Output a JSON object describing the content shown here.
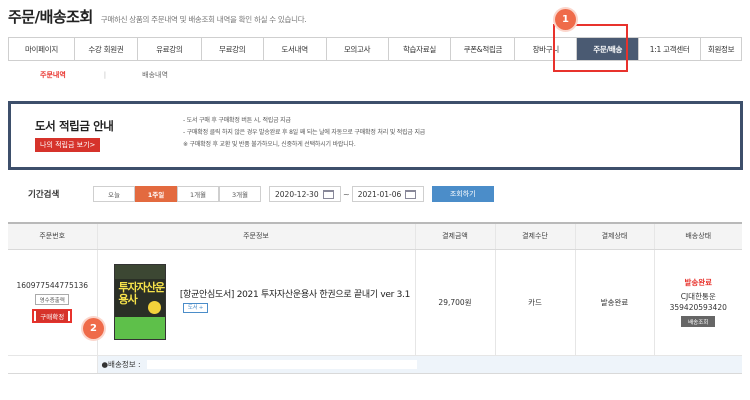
{
  "header": {
    "title": "주문/배송조회",
    "subtitle": "구매하신 상품의 주문내역 및 배송조회 내역을 확인 하실 수 있습니다."
  },
  "nav": {
    "items": [
      {
        "label": "마이페이지"
      },
      {
        "label": "수강 회원권"
      },
      {
        "label": "유료강의"
      },
      {
        "label": "무료강의"
      },
      {
        "label": "도서내역"
      },
      {
        "label": "모의고사"
      },
      {
        "label": "학습자료실"
      },
      {
        "label": "쿠폰&적립금"
      },
      {
        "label": "장바구니"
      },
      {
        "label": "주문/배송",
        "active": true
      },
      {
        "label": "1:1 고객센터"
      },
      {
        "label": "회원정보"
      }
    ]
  },
  "subtabs": {
    "order_history": "주문내역",
    "separator": "|",
    "delivery_history": "배송내역"
  },
  "info_panel": {
    "title": "도서 적립금 안내",
    "button_label": "나의 적립금 보기>",
    "lines": [
      "- 도서 구매 후 구매확정 버튼 시, 적립금 지급",
      "- 구매확정 클릭 하지 않은 경우 발송완료 후 8일 째 되는 날에 자동으로 구매확정 처리 및 적립금 지급",
      "※ 구매확정 후 교환 및 반품 불가하오니, 신중하게 선택하시기 바랍니다."
    ]
  },
  "period": {
    "label": "기간검색",
    "buttons": [
      "오늘",
      "1주일",
      "1개월",
      "3개월"
    ],
    "active_index": 1,
    "start_date": "2020-12-30",
    "tilde": "~",
    "end_date": "2021-01-06",
    "search_label": "조회하기"
  },
  "table": {
    "headers": [
      "주문번호",
      "주문정보",
      "결제금액",
      "결제수단",
      "결제상태",
      "배송상태"
    ],
    "row": {
      "order_no": "160977544775136",
      "receipt_label": "영수증출력",
      "confirm_label": "구매확정",
      "book_title": "[항균안심도서] 2021 투자자산운용사 한권으로 끝내기 ver 3.1",
      "book_tag": "도서 +",
      "cover_title": "투자자산운용사",
      "amount": "29,700원",
      "method": "카드",
      "pay_status": "발송완료",
      "ship_status": "발송완료",
      "carrier": "CJ대한통운",
      "tracking_no": "359420593420",
      "track_label": "배송조회",
      "ship_info_label": "●배송정보 :"
    }
  },
  "callouts": {
    "first": "1",
    "second": "2"
  },
  "colors": {
    "accent_red": "#e8322c",
    "nav_active": "#4a5a72",
    "period_active": "#e36a3f",
    "search_blue": "#4b8dc9",
    "panel_border": "#3d4f6b"
  }
}
